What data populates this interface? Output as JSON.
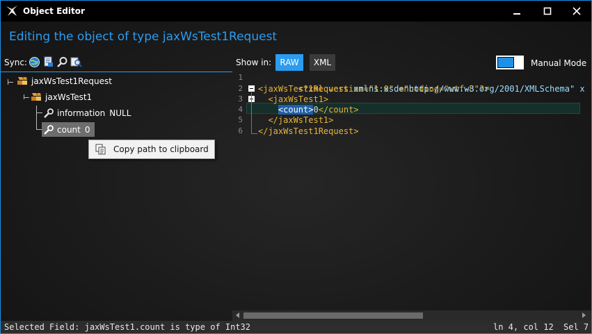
{
  "window": {
    "title": "Object Editor",
    "accent_color": "#1e90e6"
  },
  "header": {
    "title": "Editing the object of type jaxWsTest1Request"
  },
  "toolbar": {
    "sync_label": "Sync:",
    "sync_buttons": [
      "sync-globe-icon",
      "sync-document-icon",
      "sync-search-icon",
      "sync-find-icon"
    ],
    "show_in_label": "Show in:",
    "tabs": [
      {
        "label": "RAW",
        "selected": true
      },
      {
        "label": "XML",
        "selected": false
      }
    ],
    "manual_mode": {
      "label": "Manual Mode",
      "on": true
    }
  },
  "tree": {
    "root": {
      "label": "jaxWsTest1Request"
    },
    "child": {
      "label": "jaxWsTest1"
    },
    "fields": [
      {
        "name": "information",
        "value": "NULL"
      },
      {
        "name": "count",
        "value": "0",
        "selected": true
      }
    ]
  },
  "context_menu": {
    "items": [
      {
        "label": "Copy path to clipboard",
        "icon": "copy-icon"
      }
    ]
  },
  "editor": {
    "line_numbers": [
      "1",
      "2",
      "3",
      "4",
      "5",
      "6"
    ],
    "lines": {
      "l1": {
        "text": "<?xml version=\"1.0\" encoding=\"utf-8\"?>"
      },
      "l2": {
        "tag_open": "<jaxWsTest1Request",
        "attr": " xmlns:xsd=",
        "str": "\"http://www.w3.org/2001/XMLSchema\"",
        "tail": " x"
      },
      "l3": {
        "indent": "  ",
        "text": "<jaxWsTest1>"
      },
      "l4": {
        "indent": "    ",
        "selected": "<count>",
        "value": "0",
        "close": "</count>"
      },
      "l5": {
        "indent": "  ",
        "text": "</jaxWsTest1>"
      },
      "l6": {
        "text": "</jaxWsTest1Request>"
      }
    }
  },
  "status": {
    "left": "Selected Field: jaxWsTest1.count is type of Int32",
    "position": "ln 4, col 12",
    "selection": "Sel 7"
  }
}
